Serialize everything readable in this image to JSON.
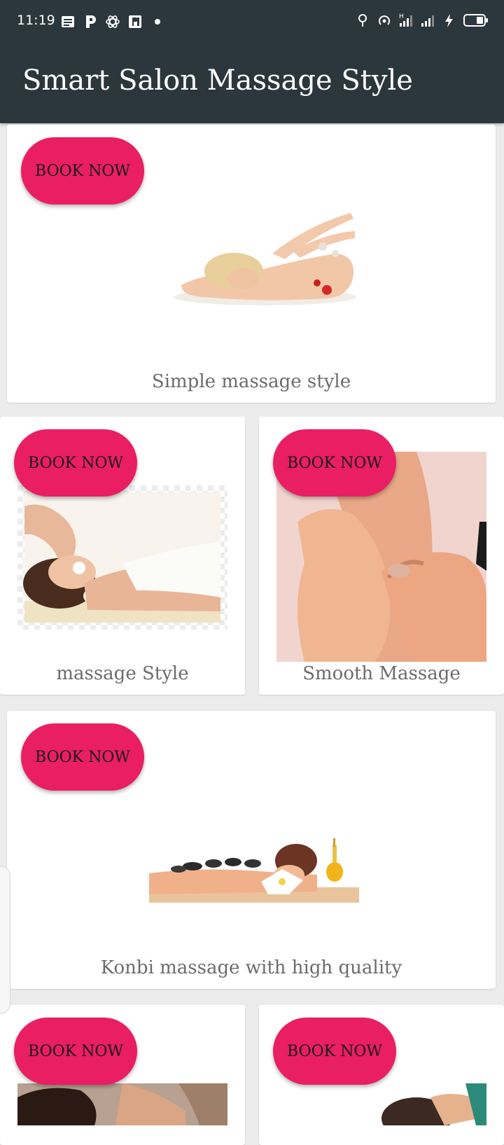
{
  "status_bar": {
    "time": "11:19",
    "left_icons": [
      "notes-icon",
      "parking-icon",
      "atom-icon",
      "paypal-icon",
      "dot-icon"
    ],
    "right_icons": [
      "location-pin-icon",
      "hotspot-icon",
      "signal-h-icon",
      "signal-icon",
      "charging-icon",
      "battery-icon"
    ]
  },
  "app_bar": {
    "title": "Smart Salon Massage Style"
  },
  "cards": [
    {
      "button": "BOOK NOW",
      "caption": "Simple massage style",
      "image": "woman-back-massage-petals"
    },
    {
      "button": "BOOK NOW",
      "caption": "massage Style",
      "image": "head-massage-towel"
    },
    {
      "button": "BOOK NOW",
      "caption": "Smooth Massage",
      "image": "foot-massage-hands"
    },
    {
      "button": "BOOK NOW",
      "caption": "Konbi massage with high quality",
      "image": "hot-stone-massage"
    },
    {
      "button": "BOOK NOW",
      "caption": "",
      "image": "neck-massage"
    },
    {
      "button": "BOOK NOW",
      "caption": "",
      "image": "scalp-massage"
    }
  ],
  "colors": {
    "app_bar": "#2c363d",
    "button": "#e91e63",
    "background": "#ececec"
  }
}
